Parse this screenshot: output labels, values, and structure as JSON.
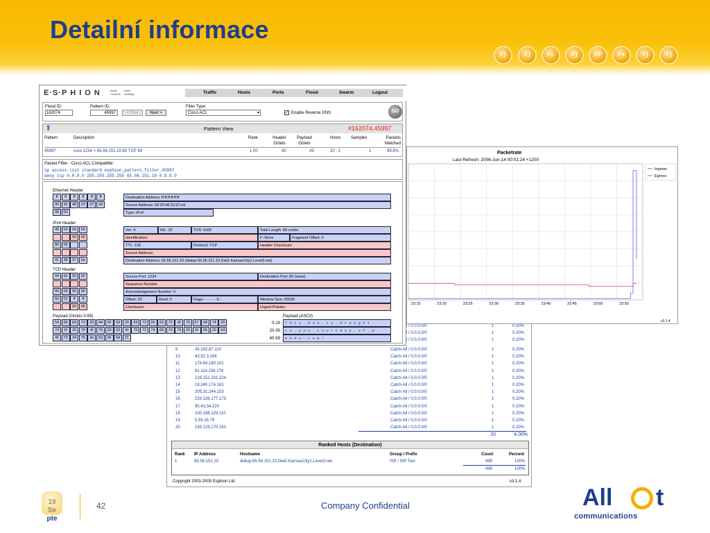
{
  "slide": {
    "title": "Detailní informace",
    "date_day": "19",
    "date_rest": "Se",
    "date_rest2": "pte",
    "page_number": "42",
    "confidential": "Company Confidential",
    "brand_top": "All",
    "brand_sub": "communications"
  },
  "nav": {
    "logo": "E·S·P H I O N",
    "small1": "Mode Controls",
    "small2": "Save Settings",
    "tabs": [
      "Traffic",
      "Hosts",
      "Ports",
      "Flood",
      "Swarm",
      "Logout"
    ]
  },
  "filter_bar": {
    "flood_id_label": "Flood ID:",
    "flood_id_value": "162074",
    "pattern_id_label": "Pattern ID:",
    "pattern_id_value": "45997",
    "prev_label": "< Prev",
    "next_label": "Next >",
    "filter_type_label": "Filter Type:",
    "filter_type_value": "Cisco ACL",
    "reverse_dns_label": "Enable Reverse DNS",
    "go_label": "GO"
  },
  "pattern_view": {
    "title": "Pattern View",
    "id": "#162074.45997",
    "headers": [
      "Pattern",
      "Description",
      "Rank",
      "Header Octets",
      "Payload Octets",
      "Hosts",
      "Samples",
      "Packets Matched"
    ],
    "row": [
      "45997",
      "xxxx:1234 > 65.56.151.10:80 TCP 89",
      "1.00",
      "40",
      "49",
      "20 : 1",
      "1",
      "99.8%"
    ]
  },
  "packet_filter": {
    "title": "Packet Filter - Cisco ACL Compatible:",
    "line1": "ip access-list standard esphion_pattern_filter_45997",
    "line2": "deny tcp 0.0.0.0 255.255.255.255 65.56.151.10 0.0.0.0"
  },
  "ethernet": {
    "label": "Ethernet Header",
    "rows": [
      [
        "ff",
        "ff",
        "ff",
        "ff",
        "ff",
        "ff"
      ],
      [
        "00",
        "30",
        "48",
        "22",
        "07",
        "e9"
      ],
      [
        "08",
        "00"
      ]
    ],
    "fields": [
      "Destination Address: ff:ff:ff:ff:ff:ff",
      "Source Address: 00:30:48:22:07:e9",
      "Type: IPv4"
    ]
  },
  "ipv4": {
    "label": "IPv4 Header",
    "rows": [
      [
        "45",
        "00",
        "00",
        "59"
      ],
      [
        "",
        "",
        "00",
        "00"
      ],
      [
        "80",
        "06",
        "",
        ""
      ],
      [
        "",
        "",
        "",
        ""
      ],
      [
        "41",
        "38",
        "97",
        "0a"
      ]
    ],
    "ver": "Ver: 4",
    "ihl": "IHL: 20",
    "tos": "TOS: 0x00",
    "total_length": "Total Length: 89 octets",
    "identification": "Identification:",
    "flags": "F: None",
    "frag": "Fragment Offset: 0",
    "ttl": "TTL: 128",
    "protocol": "Protocol: TCP",
    "checksum": "Header Checksum:",
    "src": "Source Address:",
    "dst": "Destination Address: 65.56.151.10 (dialup-65.56.151.10.Dial1.KansasCity1.Level3.net)"
  },
  "tcp": {
    "label": "TCP Header",
    "rows": [
      [
        "04",
        "d2",
        "00",
        "50"
      ],
      [
        "",
        "",
        "",
        ""
      ],
      [
        "00",
        "00",
        "00",
        "00"
      ],
      [
        "50",
        "02",
        "ff",
        "ff"
      ],
      [
        "",
        "",
        "00",
        "00"
      ]
    ],
    "src_port": "Source Port: 1234",
    "dst_port": "Destination Port: 80 (www)",
    "seq": "Sequence Number:",
    "ack": "Acknowledgement Number: 0",
    "offset": "Offset: 20",
    "rsvd": "Rsvd: 0",
    "flags": "Flags: - - - - - S -",
    "window": "Window Size: 65535",
    "checksum": "Checksum:",
    "urgent": "Urgent Pointer:"
  },
  "payload": {
    "label": "Payload (Octets 0-59)",
    "rows": [
      [
        "54",
        "68",
        "69",
        "73",
        "20",
        "44",
        "6f",
        "53",
        "20",
        "69",
        "73",
        "20",
        "62",
        "72",
        "6f",
        "75",
        "67",
        "68",
        "74",
        "20"
      ],
      [
        "74",
        "6f",
        "20",
        "79",
        "6f",
        "75",
        "20",
        "63",
        "6f",
        "75",
        "72",
        "74",
        "65",
        "73",
        "79",
        "20",
        "6f",
        "66",
        "20",
        "64"
      ],
      [
        "6f",
        "73",
        "34",
        "75",
        "2e",
        "63",
        "6f",
        "6d",
        "21"
      ]
    ],
    "ascii_label": "Payload (ASCII)",
    "ascii_ranges": [
      "0-19",
      "20-39",
      "40-59"
    ],
    "ascii_lines": [
      "T h i s . D o S . i s . b r o u g h t",
      "t o . y o u . c o u r t e s y . o f . d",
      "o s 4 u . c o m !"
    ]
  },
  "chart_data": {
    "type": "line",
    "title": "Packetrate",
    "subtitle": "Last Refresh: 2006-Jun-14 00:01:24 +1200",
    "x": [
      "23:15",
      "23:20",
      "23:25",
      "23:30",
      "23:35",
      "23:40",
      "23:45",
      "23:50",
      "23:55"
    ],
    "series": [
      {
        "name": "Ingress",
        "values": [
          0.9,
          0.9,
          0.9,
          0.9,
          0.9,
          0.9,
          0.9,
          1.0,
          5.0,
          95,
          30
        ]
      },
      {
        "name": "Egress",
        "values": [
          12,
          11,
          11,
          11,
          10,
          10,
          10,
          10,
          10,
          12,
          12
        ]
      }
    ],
    "legend": "top-right",
    "version": "v3.1.4",
    "colors": {
      "ingress": "#6f74ee",
      "egress": "#e06060"
    }
  },
  "hosts_table": {
    "partial_rows": [
      {
        "group": "Catch-All / 0.0.0.0/0",
        "count": "1",
        "pct": "0.20%"
      },
      {
        "group": "Catch-All / 0.0.0.0/0",
        "count": "1",
        "pct": "0.20%"
      },
      {
        "group": "Catch-All / 0.0.0.0/0",
        "count": "1",
        "pct": "0.20%"
      }
    ],
    "rows": [
      {
        "rank": "9",
        "ip": "45.242.87.110",
        "group": "Catch-All / 0.0.0.0/0",
        "count": "1",
        "pct": "0.20%"
      },
      {
        "rank": "10",
        "ip": "43.52.3.106",
        "group": "Catch-All / 0.0.0.0/0",
        "count": "1",
        "pct": "0.20%"
      },
      {
        "rank": "11",
        "ip": "178.64.180.101",
        "group": "Catch-All / 0.0.0.0/0",
        "count": "1",
        "pct": "0.20%"
      },
      {
        "rank": "12",
        "ip": "91.114.236.178",
        "group": "Catch-All / 0.0.0.0/0",
        "count": "1",
        "pct": "0.20%"
      },
      {
        "rank": "13",
        "ip": "218.151.201.224",
        "group": "Catch-All / 0.0.0.0/0",
        "count": "1",
        "pct": "0.20%"
      },
      {
        "rank": "14",
        "ip": "19.240.174.161",
        "group": "Catch-All / 0.0.0.0/0",
        "count": "1",
        "pct": "0.20%"
      },
      {
        "rank": "15",
        "ip": "205.31.244.153",
        "group": "Catch-All / 0.0.0.0/0",
        "count": "1",
        "pct": "0.20%"
      },
      {
        "rank": "16",
        "ip": "233.136.177.173",
        "group": "Catch-All / 0.0.0.0/0",
        "count": "1",
        "pct": "0.20%"
      },
      {
        "rank": "17",
        "ip": "95.43.34.220",
        "group": "Catch-All / 0.0.0.0/0",
        "count": "1",
        "pct": "0.20%"
      },
      {
        "rank": "18",
        "ip": "100.198.129.110",
        "group": "Catch-All / 0.0.0.0/0",
        "count": "1",
        "pct": "0.20%"
      },
      {
        "rank": "19",
        "ip": "5.59.16.79",
        "group": "Catch-All / 0.0.0.0/0",
        "count": "1",
        "pct": "0.20%"
      },
      {
        "rank": "20",
        "ip": "193.129.170.161",
        "group": "Catch-All / 0.0.0.0/0",
        "count": "1",
        "pct": "0.20%"
      }
    ],
    "total_count": "20",
    "total_pct": "4.00%"
  },
  "ranked_dest": {
    "title": "Ranked Hosts (Destination)",
    "headers": [
      "Rank",
      "IP Address",
      "Hostname",
      "Group / Prefix",
      "Count",
      "Percent"
    ],
    "row": [
      "1",
      "65.56.151.10",
      "dialup-65.56.151.10.Dial1.KansasCity1.Level3.net",
      "ISP / ISP Two",
      "499",
      "100%"
    ],
    "total_count": "499",
    "total_pct": "100%"
  },
  "copyright": "Copyright 2003-2005 Esphion Ltd.",
  "version": "v3.1.4"
}
